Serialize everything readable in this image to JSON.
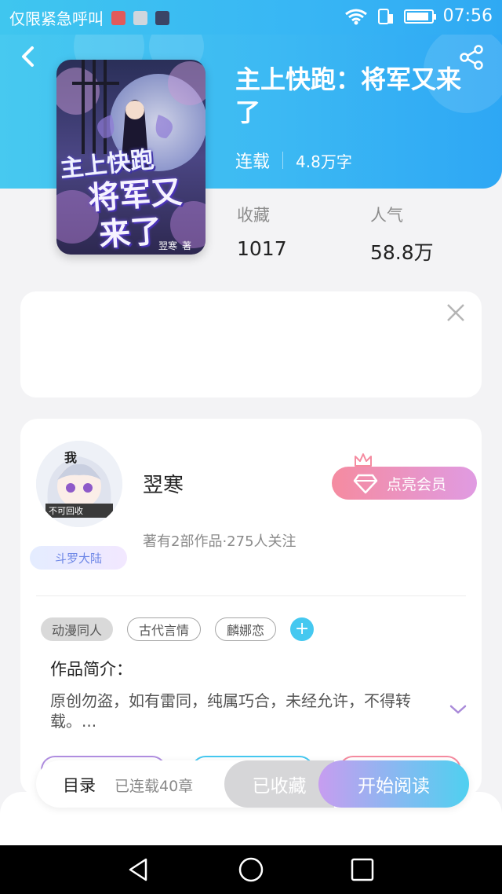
{
  "status_bar": {
    "carrier": "仅限紧急呼叫",
    "time": "07:56",
    "battery_level": 0.9
  },
  "header": {
    "title": "主上快跑：将军又来了",
    "status": "连载",
    "word_count": "4.8万字",
    "back_icon": "chevron-left-icon",
    "share_icon": "share-icon"
  },
  "stats": {
    "favorites_label": "收藏",
    "favorites_value": "1017",
    "popularity_label": "人气",
    "popularity_value": "58.8万"
  },
  "cover": {
    "line1": "主上快跑",
    "line2": "将军又",
    "line3": "来了",
    "author": "翌寒",
    "author_suffix": "著"
  },
  "ad": {
    "close_icon": "close-icon"
  },
  "author": {
    "name": "翌寒",
    "stats": "著有2部作品·275人关注",
    "badge": "斗罗大陆",
    "avatar_text_top": "我",
    "avatar_text_bottom": "不可回收",
    "vip_label": "点亮会员"
  },
  "tags": [
    "动漫同人",
    "古代言情",
    "麟娜恋"
  ],
  "intro": {
    "label": "作品简介：",
    "text": "原创勿盗，如有雷同，纯属巧合，未经允许，不得转载。..."
  },
  "action_bar": {
    "toc_label": "目录",
    "toc_count": "已连载40章",
    "fav_label": "已收藏",
    "read_label": "开始阅读"
  },
  "colors": {
    "header_blue": "#38b6f4",
    "accent_cyan": "#45c8f0",
    "vip_pink": "#f58ba0",
    "vip_purple": "#e09be2"
  }
}
